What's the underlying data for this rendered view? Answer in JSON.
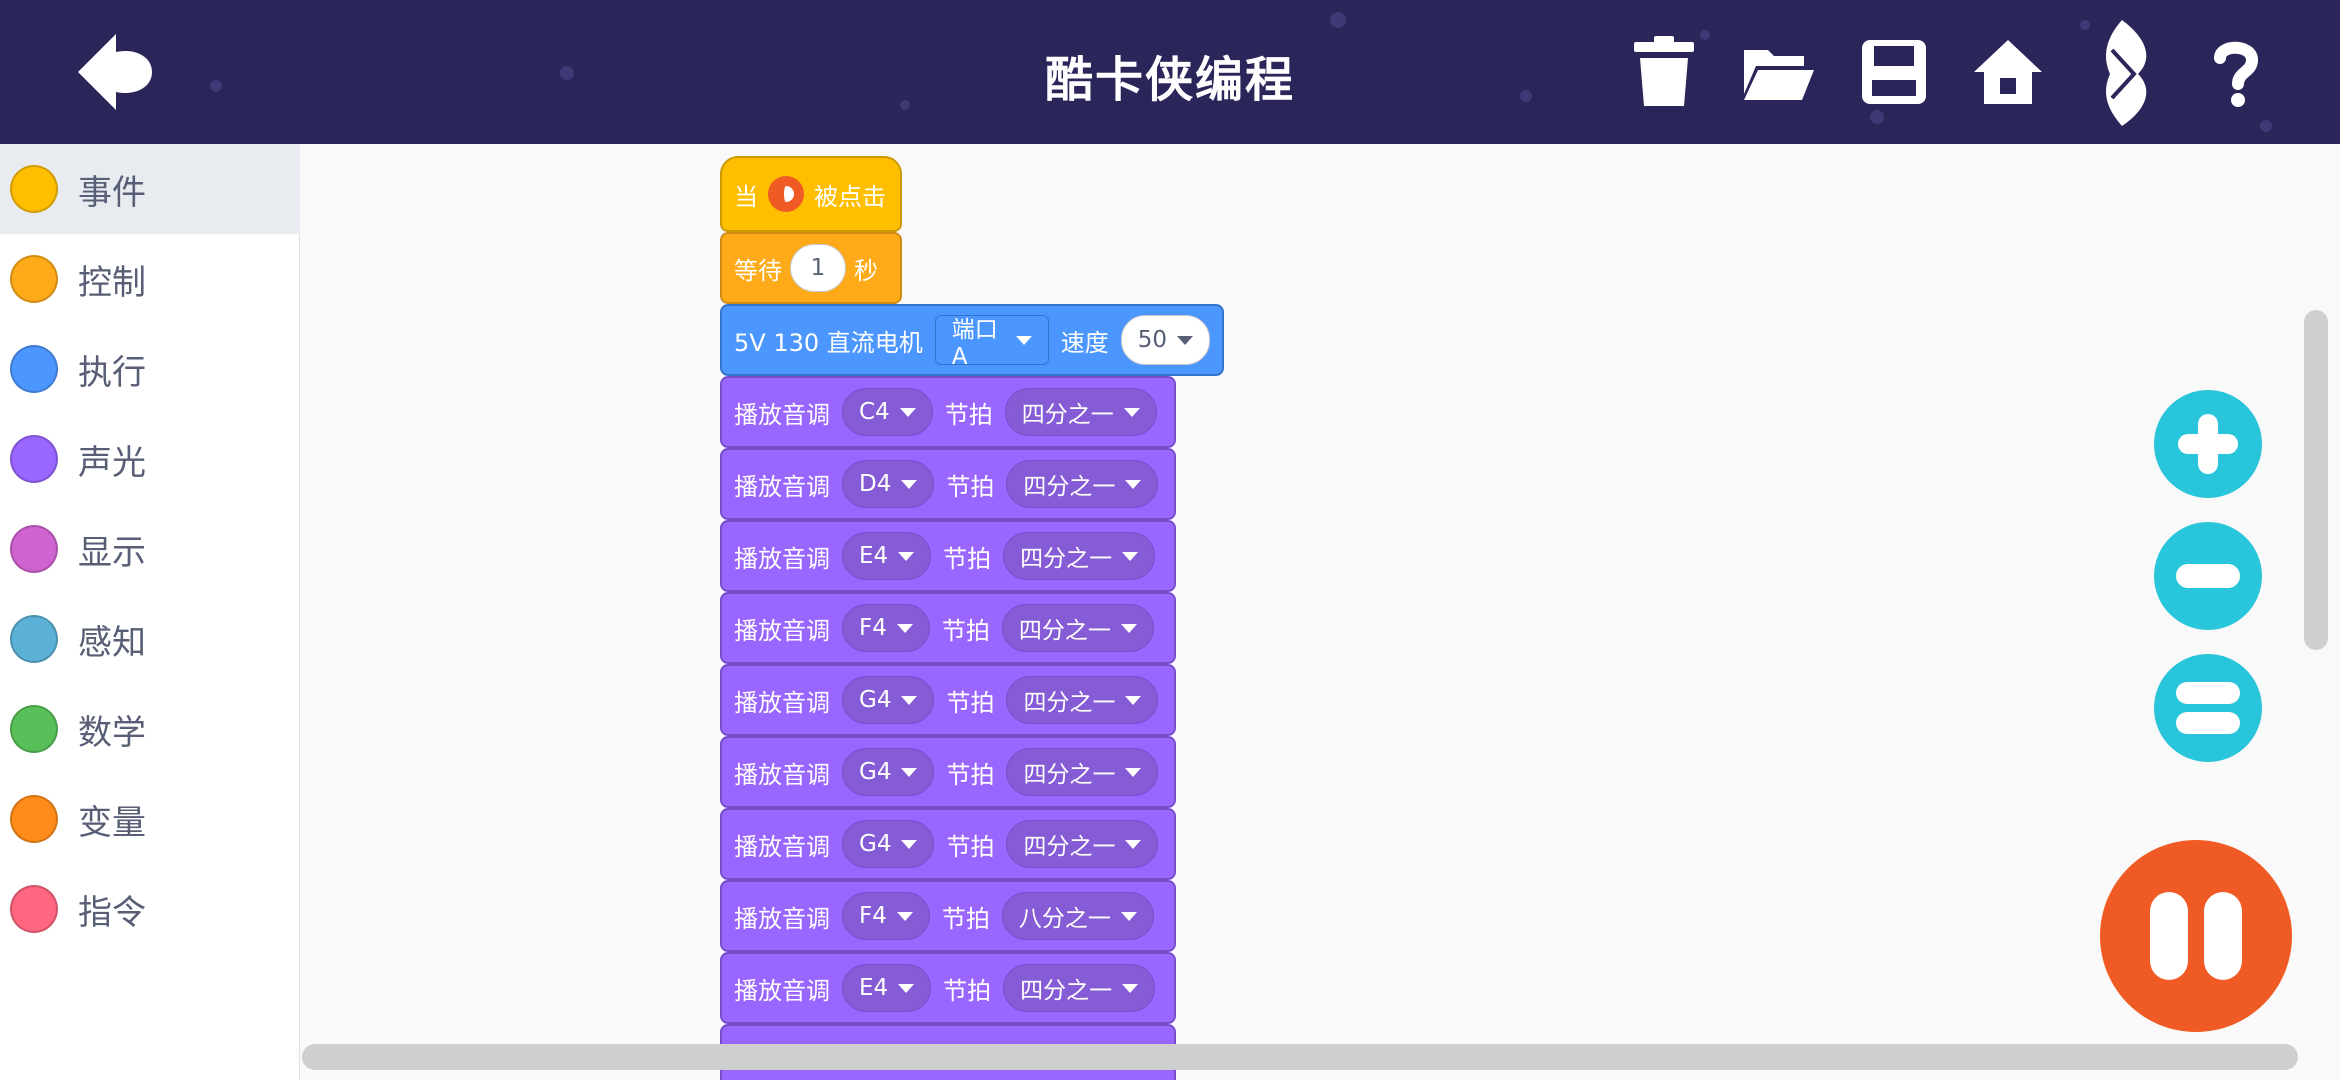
{
  "header": {
    "title": "酷卡侠编程",
    "icons": [
      "back-icon",
      "trash-icon",
      "folder-open-icon",
      "save-icon",
      "home-icon",
      "bluetooth-icon",
      "help-icon"
    ]
  },
  "sidebar": {
    "items": [
      {
        "label": "事件",
        "color": "#ffbf00"
      },
      {
        "label": "控制",
        "color": "#ffab19"
      },
      {
        "label": "执行",
        "color": "#4c97ff"
      },
      {
        "label": "声光",
        "color": "#9966ff"
      },
      {
        "label": "显示",
        "color": "#cf63cf"
      },
      {
        "label": "感知",
        "color": "#5cb1d6"
      },
      {
        "label": "数学",
        "color": "#59c059"
      },
      {
        "label": "变量",
        "color": "#ff8c1a"
      },
      {
        "label": "指令",
        "color": "#ff6680"
      }
    ]
  },
  "blocks": {
    "hat": {
      "before": "当",
      "after": "被点击",
      "icon": "flag-icon"
    },
    "wait": {
      "label": "等待",
      "value": "1",
      "unit": "秒"
    },
    "motor": {
      "label": "5V 130 直流电机",
      "port": "端口A",
      "speed_label": "速度",
      "speed": "50"
    },
    "tone_label": "播放音调",
    "beat_label": "节拍",
    "tones": [
      {
        "note": "C4",
        "beat": "四分之一"
      },
      {
        "note": "D4",
        "beat": "四分之一"
      },
      {
        "note": "E4",
        "beat": "四分之一"
      },
      {
        "note": "F4",
        "beat": "四分之一"
      },
      {
        "note": "G4",
        "beat": "四分之一"
      },
      {
        "note": "G4",
        "beat": "四分之一"
      },
      {
        "note": "G4",
        "beat": "四分之一"
      },
      {
        "note": "F4",
        "beat": "八分之一"
      },
      {
        "note": "E4",
        "beat": "四分之一"
      }
    ]
  },
  "colors": {
    "header_bg": "#2b2659",
    "event": "#ffbf00",
    "control": "#ffab19",
    "motion": "#4c97ff",
    "sound": "#9966ff",
    "zoom": "#29c6db",
    "stop": "#f05a24"
  }
}
